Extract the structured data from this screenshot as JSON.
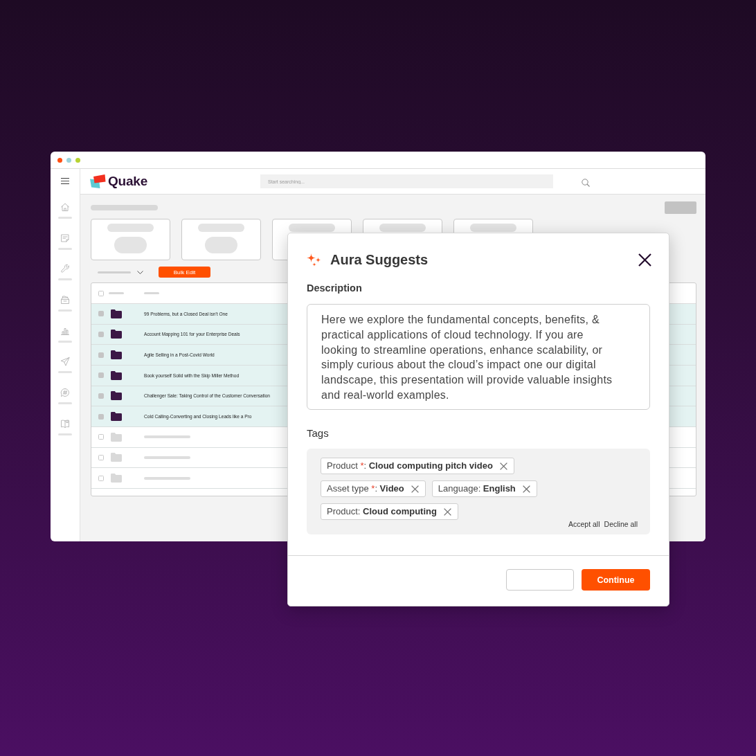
{
  "app": {
    "logo_text": "Quake",
    "search": {
      "placeholder": "Start searching..."
    }
  },
  "toolbar": {
    "bulk_edit_button": "Bulk Edit"
  },
  "table": {
    "header_checkbox": {
      "checked": false
    },
    "rows": [
      {
        "kind": "item",
        "title": "99 Problems, but a Closed Deal isn’t One",
        "selected": true,
        "checked": true
      },
      {
        "kind": "item",
        "title": "Account Mapping 101 for your Enterprise Deals",
        "selected": true,
        "checked": true
      },
      {
        "kind": "item",
        "title": "Agile Selling in a Post-Covid World",
        "selected": true,
        "checked": true
      },
      {
        "kind": "item",
        "title": "Book yourself Solid with the Skip Miller Method",
        "selected": true,
        "checked": true
      },
      {
        "kind": "item",
        "title": "Challenger Sale: Taking Control of the Customer Conversation",
        "selected": true,
        "checked": true
      },
      {
        "kind": "item",
        "title": "Cold Calling-Converting and Closing Leads like a Pro",
        "selected": true,
        "checked": true
      },
      {
        "kind": "placeholder",
        "selected": false,
        "checked": false
      },
      {
        "kind": "placeholder",
        "selected": false,
        "checked": false
      },
      {
        "kind": "placeholder",
        "selected": false,
        "checked": false
      }
    ]
  },
  "modal": {
    "title": "Aura Suggests",
    "description_label": "Description",
    "description": "Here we explore the fundamental concepts, benefits, & practical applications of cloud technology. If you are looking to streamline operations, enhance scalability, or simply curious about the cloud’s impact one our digital landscape, this presentation will provide valuable insights and real-world examples.",
    "tags_label": "Tags",
    "tags": [
      {
        "label": "Product",
        "required_mark": "*",
        "separator": ":",
        "value": "Cloud computing pitch video"
      },
      {
        "label": "Asset type",
        "required_mark": "*",
        "separator": ":",
        "value": "Video"
      },
      {
        "label": "Language",
        "separator": ":",
        "value": "English"
      },
      {
        "label": "Product",
        "separator": ":",
        "value": "Cloud computing"
      }
    ],
    "accept_all": "Accept all",
    "decline_all": "Decline all",
    "continue_button": "Continue"
  }
}
